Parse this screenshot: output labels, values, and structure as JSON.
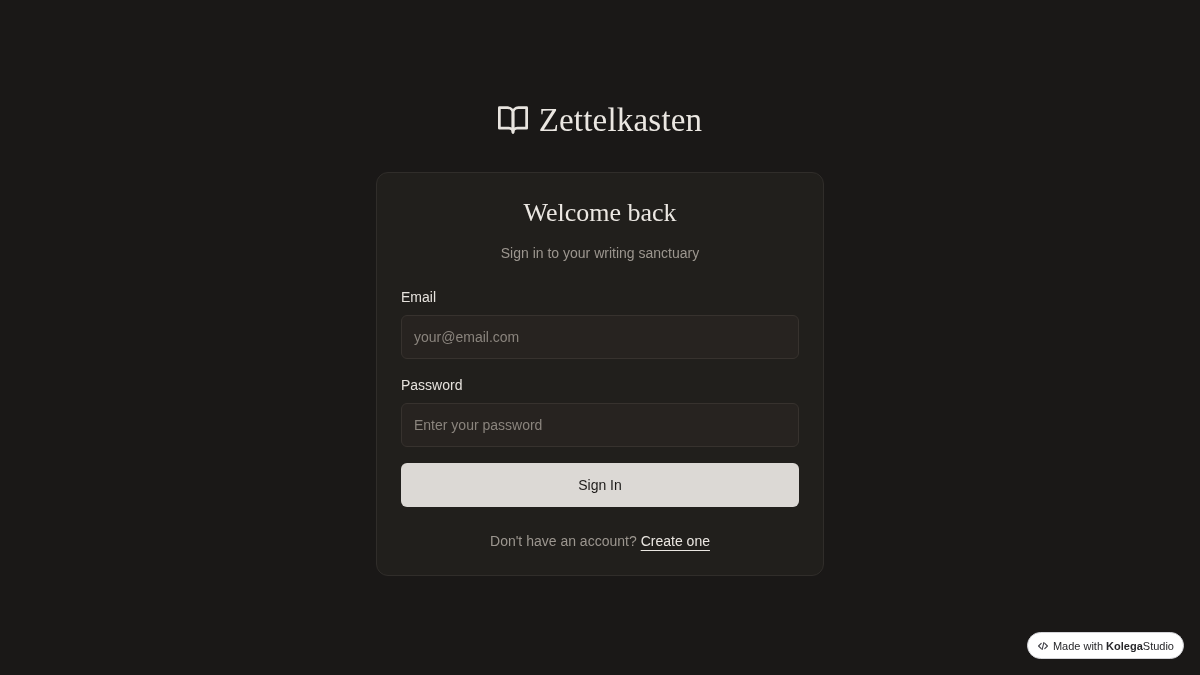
{
  "brand": {
    "name": "Zettelkasten"
  },
  "card": {
    "title": "Welcome back",
    "subtitle": "Sign in to your writing sanctuary",
    "fields": [
      {
        "label": "Email",
        "placeholder": "your@email.com"
      },
      {
        "label": "Password",
        "placeholder": "Enter your password"
      }
    ],
    "submit": "Sign In",
    "footer": {
      "text": "Don't have an account?",
      "link": "Create one"
    }
  },
  "badge": {
    "text": "Made with **Kolega**Studio"
  }
}
